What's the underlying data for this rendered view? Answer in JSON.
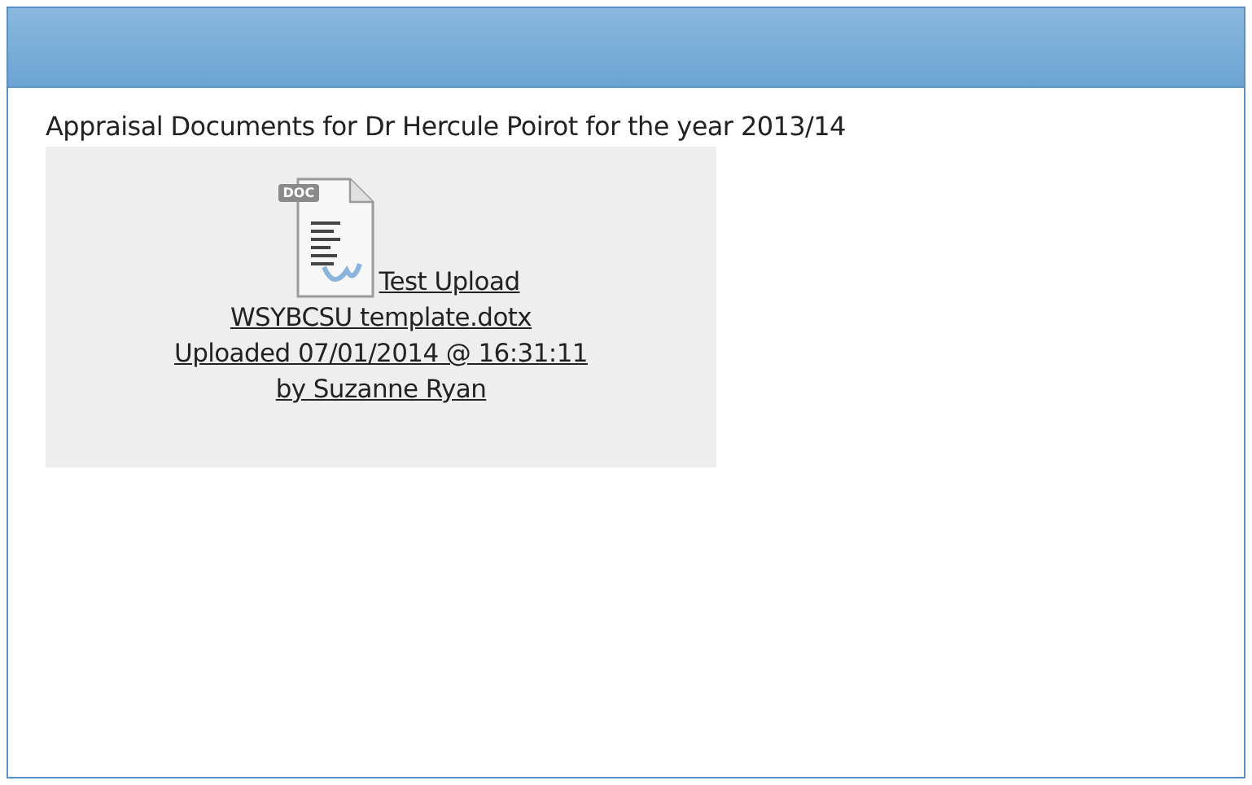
{
  "heading": "Appraisal Documents for Dr Hercule Poirot for the year 2013/14",
  "documents": [
    {
      "icon_label": "DOC",
      "lines": [
        "Test Upload",
        "WSYBCSU template.dotx",
        "Uploaded 07/01/2014 @ 16:31:11",
        "by Suzanne Ryan"
      ]
    }
  ]
}
